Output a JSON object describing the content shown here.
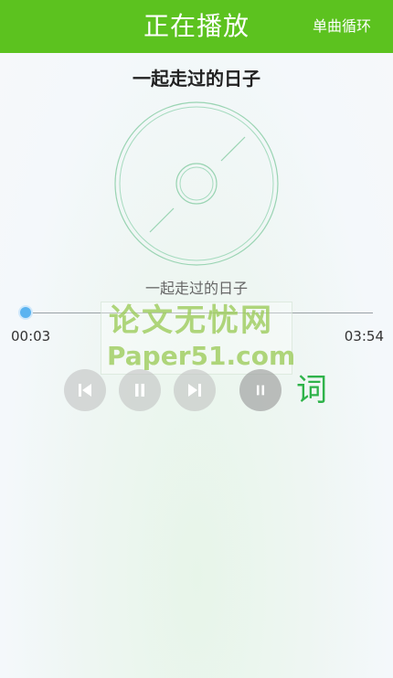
{
  "header": {
    "title": "正在播放",
    "play_mode": "单曲循环"
  },
  "song": {
    "title": "一起走过的日子",
    "subtitle": "一起走过的日子"
  },
  "progress": {
    "current_time": "00:03",
    "total_time": "03:54",
    "fraction": 0.013
  },
  "controls": {
    "lyrics_label": "词"
  },
  "watermark": {
    "line1": "论文无忧网",
    "line2": "Paper51.com"
  },
  "colors": {
    "accent": "#5cc21f",
    "lyrics": "#2fb34a",
    "progress": "#4aa3e8",
    "disc_outline": "#8fd0a8"
  },
  "icons": [
    "compact-disc-icon",
    "previous-track-icon",
    "pause-icon",
    "next-track-icon",
    "play-pause-icon"
  ]
}
